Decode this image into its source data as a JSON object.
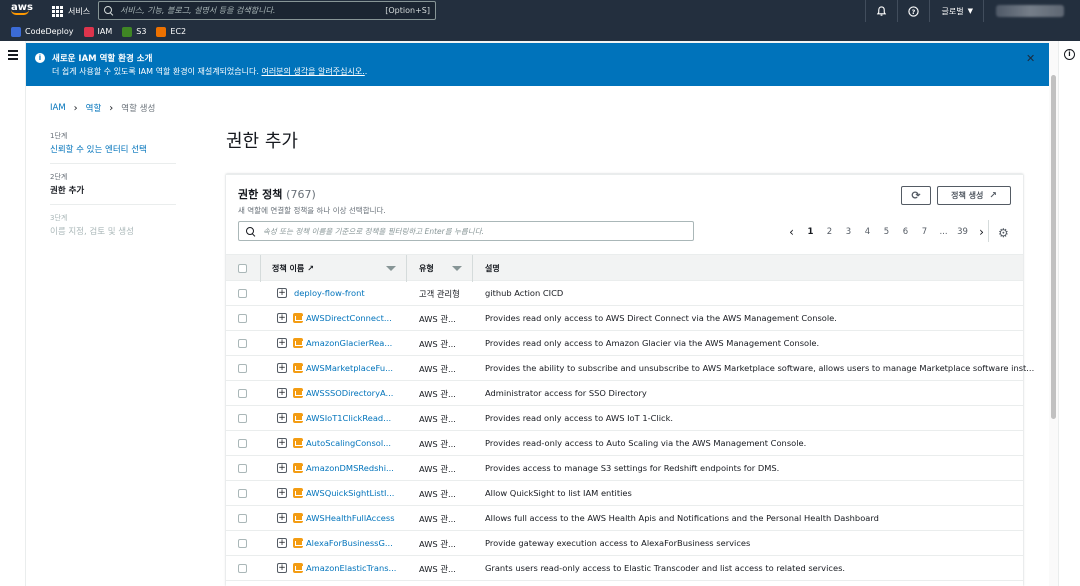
{
  "topnav": {
    "logo": "aws",
    "services": "서비스",
    "search_placeholder": "서비스, 기능, 블로그, 설명서 등을 검색합니다.",
    "search_shortcut": "[Option+S]",
    "region": "글로벌"
  },
  "favorites": [
    {
      "label": "CodeDeploy",
      "color": "#3b6bd6"
    },
    {
      "label": "IAM",
      "color": "#dd344c"
    },
    {
      "label": "S3",
      "color": "#3f8624"
    },
    {
      "label": "EC2",
      "color": "#ed7100"
    }
  ],
  "flash": {
    "title": "새로운 IAM 역할 환경 소개",
    "desc": "더 쉽게 사용할 수 있도록 IAM 역할 환경이 재설계되었습니다.",
    "link": "여러분의 생각을 알려주십시오.",
    "link_suffix": "."
  },
  "breadcrumb": {
    "iam": "IAM",
    "roles": "역할",
    "current": "역할 생성"
  },
  "wizard": [
    {
      "num": "1단계",
      "label": "신뢰할 수 있는 엔터티 선택",
      "state": "done"
    },
    {
      "num": "2단계",
      "label": "권한 추가",
      "state": "active"
    },
    {
      "num": "3단계",
      "label": "이름 지정, 검토 및 생성",
      "state": "todo"
    }
  ],
  "page_title": "권한 추가",
  "panel": {
    "title": "권한 정책",
    "count": "(767)",
    "desc": "새 역할에 연결할 정책을 하나 이상 선택합니다.",
    "create_label": "정책 생성",
    "filter_placeholder": "속성 또는 정책 이름을 기준으로 정책을 필터링하고 Enter를 누릅니다."
  },
  "pagination": {
    "pages": [
      "1",
      "2",
      "3",
      "4",
      "5",
      "6",
      "7",
      "...",
      "39"
    ],
    "current": "1"
  },
  "columns": {
    "name": "정책 이름",
    "type": "유형",
    "desc": "설명"
  },
  "rows": [
    {
      "name": "deploy-flow-front",
      "type": "고객 관리형",
      "desc": "github Action CICD",
      "aws": false
    },
    {
      "name": "AWSDirectConnect...",
      "type": "AWS 관...",
      "desc": "Provides read only access to AWS Direct Connect via the AWS Management Console.",
      "aws": true
    },
    {
      "name": "AmazonGlacierRea...",
      "type": "AWS 관...",
      "desc": "Provides read only access to Amazon Glacier via the AWS Management Console.",
      "aws": true
    },
    {
      "name": "AWSMarketplaceFu...",
      "type": "AWS 관...",
      "desc": "Provides the ability to subscribe and unsubscribe to AWS Marketplace software, allows users to manage Marketplace software inst...",
      "aws": true
    },
    {
      "name": "AWSSSODirectoryA...",
      "type": "AWS 관...",
      "desc": "Administrator access for SSO Directory",
      "aws": true
    },
    {
      "name": "AWSIoT1ClickRead...",
      "type": "AWS 관...",
      "desc": "Provides read only access to AWS IoT 1-Click.",
      "aws": true
    },
    {
      "name": "AutoScalingConsol...",
      "type": "AWS 관...",
      "desc": "Provides read-only access to Auto Scaling via the AWS Management Console.",
      "aws": true
    },
    {
      "name": "AmazonDMSRedshi...",
      "type": "AWS 관...",
      "desc": "Provides access to manage S3 settings for Redshift endpoints for DMS.",
      "aws": true
    },
    {
      "name": "AWSQuickSightListI...",
      "type": "AWS 관...",
      "desc": "Allow QuickSight to list IAM entities",
      "aws": true
    },
    {
      "name": "AWSHealthFullAccess",
      "type": "AWS 관...",
      "desc": "Allows full access to the AWS Health Apis and Notifications and the Personal Health Dashboard",
      "aws": true
    },
    {
      "name": "AlexaForBusinessG...",
      "type": "AWS 관...",
      "desc": "Provide gateway execution access to AlexaForBusiness services",
      "aws": true
    },
    {
      "name": "AmazonElasticTrans...",
      "type": "AWS 관...",
      "desc": "Grants users read-only access to Elastic Transcoder and list access to related services.",
      "aws": true
    }
  ]
}
